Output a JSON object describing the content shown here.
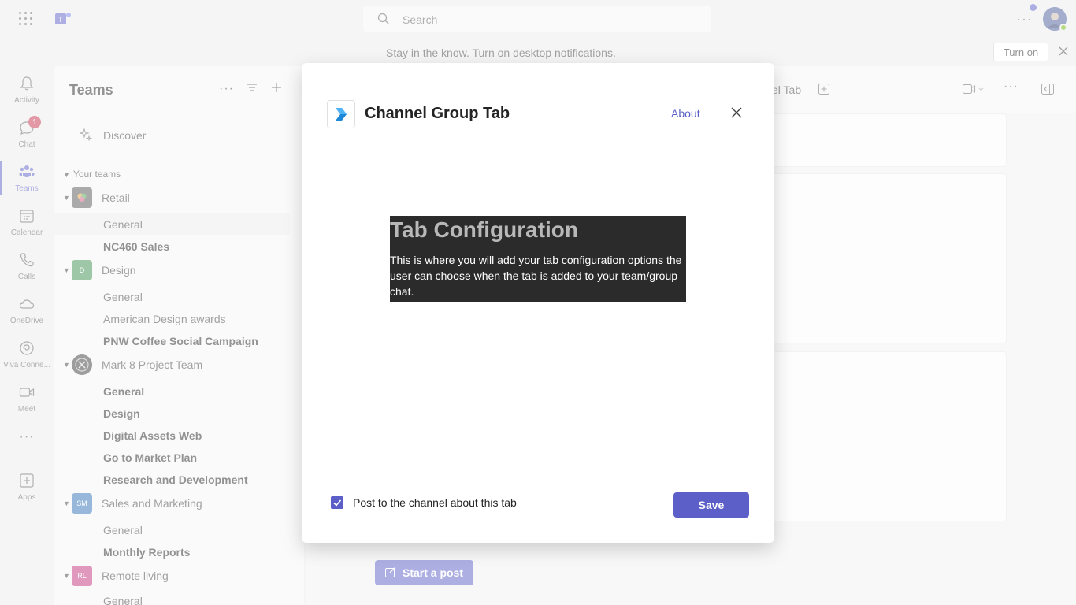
{
  "topbar": {
    "search_placeholder": "Search",
    "more_label": "···"
  },
  "banner": {
    "text": "Stay in the know. Turn on desktop notifications.",
    "turn_on_label": "Turn on"
  },
  "rail": {
    "items": [
      {
        "label": "Activity",
        "icon": "bell-icon"
      },
      {
        "label": "Chat",
        "icon": "chat-icon",
        "badge": "1"
      },
      {
        "label": "Teams",
        "icon": "teams-icon"
      },
      {
        "label": "Calendar",
        "icon": "calendar-icon"
      },
      {
        "label": "Calls",
        "icon": "phone-icon"
      },
      {
        "label": "OneDrive",
        "icon": "cloud-icon"
      },
      {
        "label": "Viva Conne...",
        "icon": "viva-icon"
      },
      {
        "label": "Meet",
        "icon": "video-icon"
      },
      {
        "label": "···",
        "icon": "more-icon"
      },
      {
        "label": "Apps",
        "icon": "apps-icon"
      }
    ]
  },
  "pane": {
    "title": "Teams",
    "discover": "Discover",
    "your_teams": "Your teams",
    "teams": [
      {
        "name": "Retail",
        "avatar": "",
        "channels": [
          {
            "name": "General",
            "bold": false
          },
          {
            "name": "NC460 Sales",
            "bold": true
          }
        ]
      },
      {
        "name": "Design",
        "avatar": "D",
        "channels": [
          {
            "name": "General",
            "bold": false
          },
          {
            "name": "American Design awards",
            "bold": false
          },
          {
            "name": "PNW Coffee Social Campaign",
            "bold": true
          }
        ]
      },
      {
        "name": "Mark 8 Project Team",
        "avatar": "",
        "channels": [
          {
            "name": "General",
            "bold": true
          },
          {
            "name": "Design",
            "bold": true
          },
          {
            "name": "Digital Assets Web",
            "bold": true
          },
          {
            "name": "Go to Market Plan",
            "bold": true
          },
          {
            "name": "Research and Development",
            "bold": true
          }
        ]
      },
      {
        "name": "Sales and Marketing",
        "avatar": "SM",
        "channels": [
          {
            "name": "General",
            "bold": false
          },
          {
            "name": "Monthly Reports",
            "bold": true
          }
        ]
      },
      {
        "name": "Remote living",
        "avatar": "RL",
        "channels": [
          {
            "name": "General",
            "bold": false
          }
        ]
      }
    ]
  },
  "main": {
    "tab_fragment": "el Tab",
    "start_post": "Start a post"
  },
  "dialog": {
    "title": "Channel Group Tab",
    "about": "About",
    "config_heading": "Tab Configuration",
    "config_text": "This is where you will add your tab configuration options the user can choose when the tab is added to your team/group chat.",
    "checkbox_label": "Post to the channel about this tab",
    "checkbox_checked": true,
    "save_label": "Save"
  },
  "colors": {
    "accent": "#5b5fc7",
    "badge": "#c4314b",
    "design_avatar": "#3b8f4f",
    "sm_avatar": "#2f6fb6",
    "rl_avatar": "#c2307a"
  }
}
